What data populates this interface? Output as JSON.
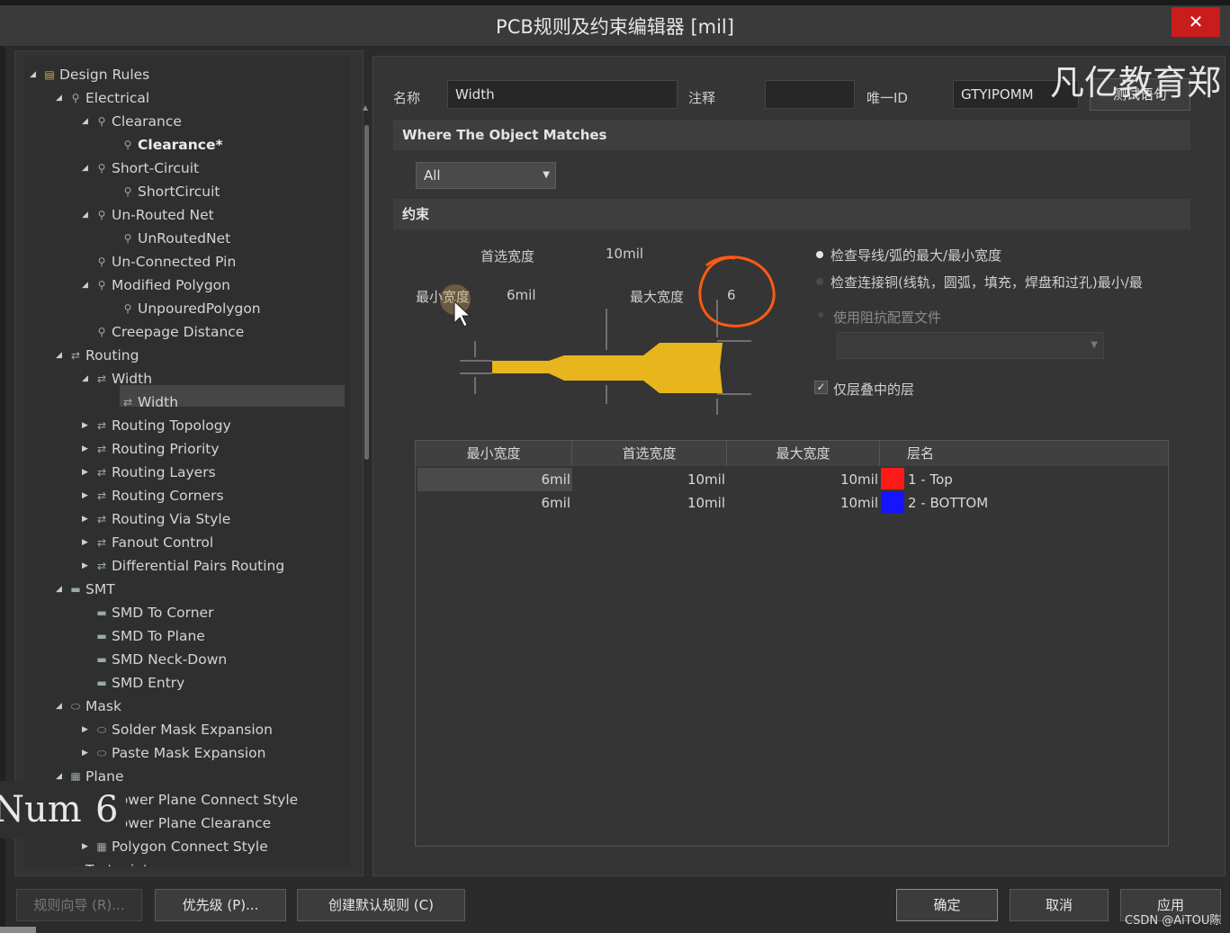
{
  "window": {
    "title": "PCB规则及约束编辑器 [mil]",
    "close_glyph": "✕"
  },
  "tree": {
    "items": [
      {
        "label": "Design Rules",
        "level": 0,
        "arrow": "◢",
        "icon": "folder-icon"
      },
      {
        "label": "Electrical",
        "level": 1,
        "arrow": "◢",
        "icon": "rule-icon"
      },
      {
        "label": "Clearance",
        "level": 2,
        "arrow": "◢",
        "icon": "rule-icon"
      },
      {
        "label": "Clearance*",
        "level": 3,
        "arrow": "",
        "icon": "rule-icon",
        "bold": true
      },
      {
        "label": "Short-Circuit",
        "level": 2,
        "arrow": "◢",
        "icon": "rule-icon"
      },
      {
        "label": "ShortCircuit",
        "level": 3,
        "arrow": "",
        "icon": "rule-icon"
      },
      {
        "label": "Un-Routed Net",
        "level": 2,
        "arrow": "◢",
        "icon": "rule-icon"
      },
      {
        "label": "UnRoutedNet",
        "level": 3,
        "arrow": "",
        "icon": "rule-icon"
      },
      {
        "label": "Un-Connected Pin",
        "level": 2,
        "arrow": "",
        "icon": "rule-icon"
      },
      {
        "label": "Modified Polygon",
        "level": 2,
        "arrow": "◢",
        "icon": "rule-icon"
      },
      {
        "label": "UnpouredPolygon",
        "level": 3,
        "arrow": "",
        "icon": "rule-icon"
      },
      {
        "label": "Creepage Distance",
        "level": 2,
        "arrow": "",
        "icon": "rule-icon"
      },
      {
        "label": "Routing",
        "level": 1,
        "arrow": "◢",
        "icon": "routing-icon"
      },
      {
        "label": "Width",
        "level": 2,
        "arrow": "◢",
        "icon": "routing-icon"
      },
      {
        "label": "Width",
        "level": 3,
        "arrow": "",
        "icon": "routing-icon",
        "selected": true
      },
      {
        "label": "Routing Topology",
        "level": 2,
        "arrow": "▶",
        "icon": "routing-icon"
      },
      {
        "label": "Routing Priority",
        "level": 2,
        "arrow": "▶",
        "icon": "routing-icon"
      },
      {
        "label": "Routing Layers",
        "level": 2,
        "arrow": "▶",
        "icon": "routing-icon"
      },
      {
        "label": "Routing Corners",
        "level": 2,
        "arrow": "▶",
        "icon": "routing-icon"
      },
      {
        "label": "Routing Via Style",
        "level": 2,
        "arrow": "▶",
        "icon": "routing-icon"
      },
      {
        "label": "Fanout Control",
        "level": 2,
        "arrow": "▶",
        "icon": "routing-icon"
      },
      {
        "label": "Differential Pairs Routing",
        "level": 2,
        "arrow": "▶",
        "icon": "routing-icon"
      },
      {
        "label": "SMT",
        "level": 1,
        "arrow": "◢",
        "icon": "smt-icon"
      },
      {
        "label": "SMD To Corner",
        "level": 2,
        "arrow": "",
        "icon": "smt-icon"
      },
      {
        "label": "SMD To Plane",
        "level": 2,
        "arrow": "",
        "icon": "smt-icon"
      },
      {
        "label": "SMD Neck-Down",
        "level": 2,
        "arrow": "",
        "icon": "smt-icon"
      },
      {
        "label": "SMD Entry",
        "level": 2,
        "arrow": "",
        "icon": "smt-icon"
      },
      {
        "label": "Mask",
        "level": 1,
        "arrow": "◢",
        "icon": "mask-icon"
      },
      {
        "label": "Solder Mask Expansion",
        "level": 2,
        "arrow": "▶",
        "icon": "mask-icon"
      },
      {
        "label": "Paste Mask Expansion",
        "level": 2,
        "arrow": "▶",
        "icon": "mask-icon"
      },
      {
        "label": "Plane",
        "level": 1,
        "arrow": "◢",
        "icon": "plane-icon"
      },
      {
        "label": "Power Plane Connect Style",
        "level": 2,
        "arrow": "",
        "icon": "plane-icon"
      },
      {
        "label": "Power Plane Clearance",
        "level": 2,
        "arrow": "",
        "icon": "plane-icon"
      },
      {
        "label": "Polygon Connect Style",
        "level": 2,
        "arrow": "▶",
        "icon": "plane-icon"
      },
      {
        "label": "Testpoint",
        "level": 1,
        "arrow": "◢",
        "icon": "testpoint-icon"
      }
    ]
  },
  "overlay": {
    "left": "Num",
    "right": "6"
  },
  "header": {
    "name_label": "名称",
    "name_value": "Width",
    "comment_label": "注释",
    "comment_value": "",
    "uid_label": "唯一ID",
    "uid_value": "GTYIPOMM",
    "test_button": "测试语句",
    "watermark": "凡亿教育郑"
  },
  "where_section": {
    "title": "Where The Object Matches",
    "select_value": "All"
  },
  "constraints": {
    "title": "约束",
    "preferred_label": "首选宽度",
    "preferred_value": "10mil",
    "min_label": "最小宽度",
    "min_value": "6mil",
    "max_label": "最大宽度",
    "max_value": "6",
    "options": [
      {
        "label": "检查导线/弧的最大/最小宽度",
        "selected": true
      },
      {
        "label": "检查连接铜(线轨，圆弧，填充，焊盘和过孔)最小/最",
        "selected": false
      }
    ],
    "impedance_label": "使用阻抗配置文件",
    "layers_only_label": "仅层叠中的层",
    "layers_only_checked": true,
    "annotation_color": "#ff5a14",
    "trace_color": "#e8b61c"
  },
  "table": {
    "headers": [
      "最小宽度",
      "首选宽度",
      "最大宽度",
      "层名"
    ],
    "rows": [
      {
        "min": "6mil",
        "preferred": "10mil",
        "max": "10mil",
        "layer": "1 - Top",
        "color": "#ff1a1a"
      },
      {
        "min": "6mil",
        "preferred": "10mil",
        "max": "10mil",
        "layer": "2 - BOTTOM",
        "color": "#1414ff"
      }
    ]
  },
  "footer": {
    "wizard": "规则向导 (R)...",
    "priorities": "优先级 (P)...",
    "create_default": "创建默认规则 (C)",
    "ok": "确定",
    "cancel": "取消",
    "apply": "应用",
    "credit": "CSDN @AiTOU陈"
  }
}
